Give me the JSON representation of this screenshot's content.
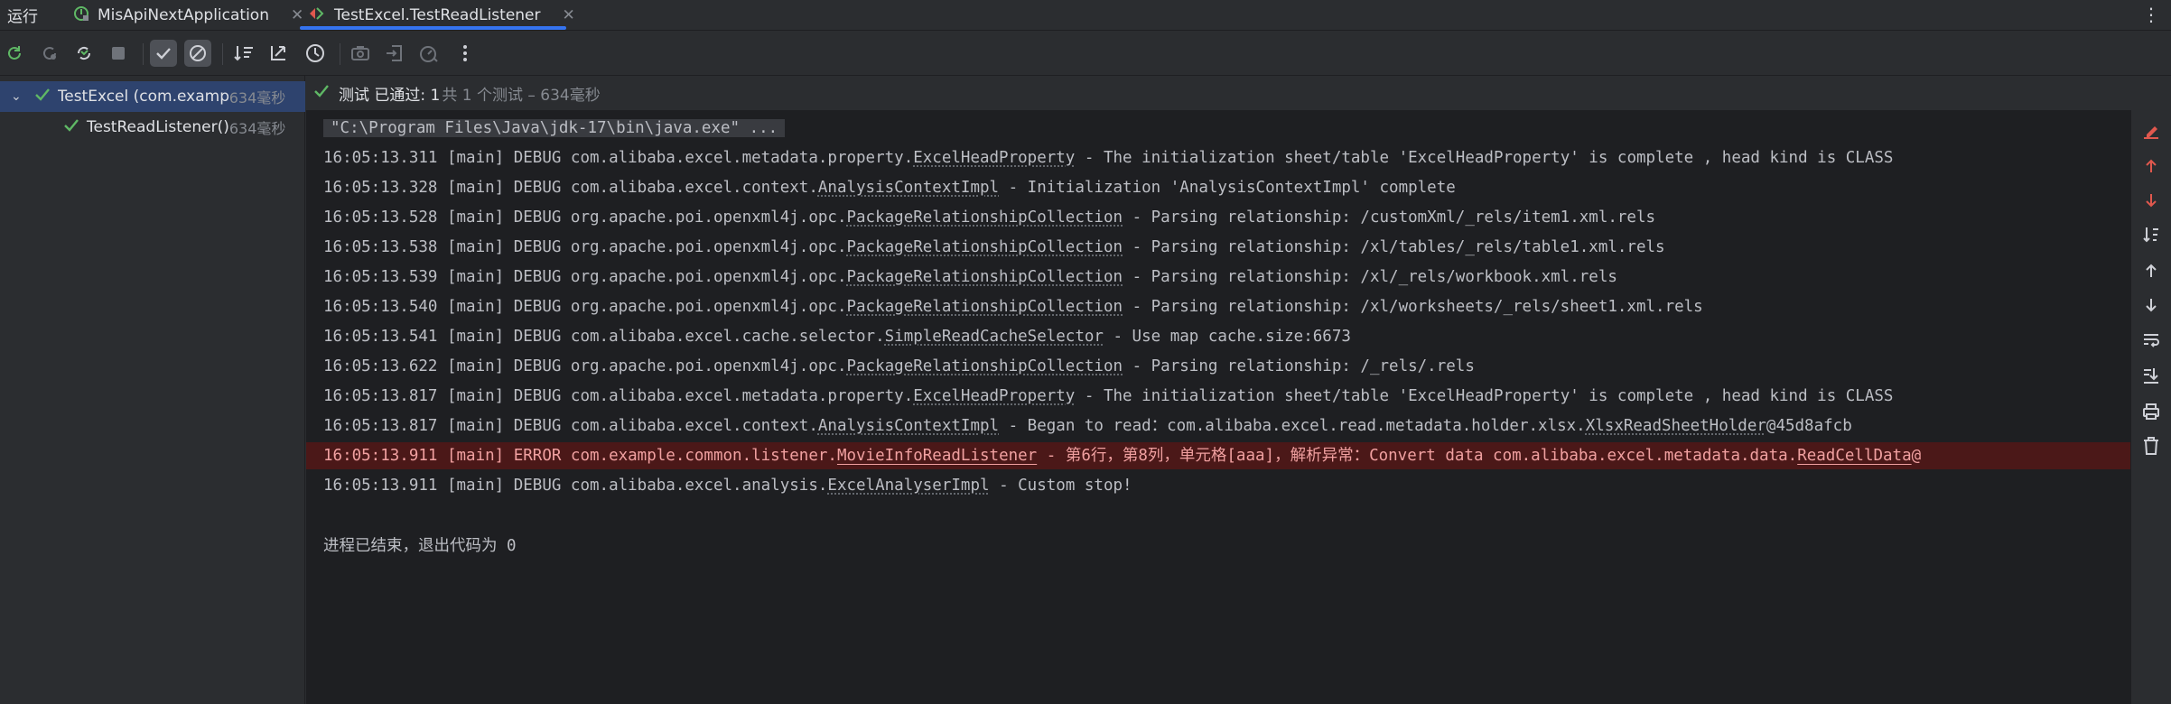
{
  "run_title": "运行",
  "tabs": [
    {
      "label": "MisApiNextApplication",
      "close": "✕"
    },
    {
      "label": "TestExcel.TestReadListener",
      "close": "✕"
    }
  ],
  "tree": {
    "root_label": "TestExcel (com.examp",
    "root_time": "634毫秒",
    "child_label": "TestReadListener()",
    "child_time": "634毫秒"
  },
  "status": {
    "passed": "测试 已通过: 1",
    "rest": "共 1 个测试 – 634毫秒"
  },
  "console": {
    "command": "\"C:\\Program Files\\Java\\jdk-17\\bin\\java.exe\" ...",
    "lines": [
      {
        "pre": "16:05:13.311 [main] DEBUG com.alibaba.excel.metadata.property.",
        "cls": "ExcelHeadProperty",
        "post": " - The initialization sheet/table 'ExcelHeadProperty' is complete , head kind is CLASS"
      },
      {
        "pre": "16:05:13.328 [main] DEBUG com.alibaba.excel.context.",
        "cls": "AnalysisContextImpl",
        "post": " - Initialization 'AnalysisContextImpl' complete"
      },
      {
        "pre": "16:05:13.528 [main] DEBUG org.apache.poi.openxml4j.opc.",
        "cls": "PackageRelationshipCollection",
        "post": " - Parsing relationship: /customXml/_rels/item1.xml.rels"
      },
      {
        "pre": "16:05:13.538 [main] DEBUG org.apache.poi.openxml4j.opc.",
        "cls": "PackageRelationshipCollection",
        "post": " - Parsing relationship: /xl/tables/_rels/table1.xml.rels"
      },
      {
        "pre": "16:05:13.539 [main] DEBUG org.apache.poi.openxml4j.opc.",
        "cls": "PackageRelationshipCollection",
        "post": " - Parsing relationship: /xl/_rels/workbook.xml.rels"
      },
      {
        "pre": "16:05:13.540 [main] DEBUG org.apache.poi.openxml4j.opc.",
        "cls": "PackageRelationshipCollection",
        "post": " - Parsing relationship: /xl/worksheets/_rels/sheet1.xml.rels"
      },
      {
        "pre": "16:05:13.541 [main] DEBUG com.alibaba.excel.cache.selector.",
        "cls": "SimpleReadCacheSelector",
        "post": " - Use map cache.size:6673"
      },
      {
        "pre": "16:05:13.622 [main] DEBUG org.apache.poi.openxml4j.opc.",
        "cls": "PackageRelationshipCollection",
        "post": " - Parsing relationship: /_rels/.rels"
      },
      {
        "pre": "16:05:13.817 [main] DEBUG com.alibaba.excel.metadata.property.",
        "cls": "ExcelHeadProperty",
        "post": " - The initialization sheet/table 'ExcelHeadProperty' is complete , head kind is CLASS"
      },
      {
        "pre": "16:05:13.817 [main] DEBUG com.alibaba.excel.context.",
        "cls": "AnalysisContextImpl",
        "post": " - Began to read：com.alibaba.excel.read.metadata.holder.xlsx.",
        "cls2": "XlsxReadSheetHolder",
        "post2": "@45d8afcb"
      },
      {
        "pre": "16:05:13.911 [main] ERROR com.example.common.listener.",
        "cls": "MovieInfoReadListener",
        "post": " - 第6行，第8列，单元格[aaa]，解析异常：Convert data com.alibaba.excel.metadata.data.",
        "cls2": "ReadCellData",
        "post2": "@"
      },
      {
        "pre": "16:05:13.911 [main] DEBUG com.alibaba.excel.analysis.",
        "cls": "ExcelAnalyserImpl",
        "post": " - Custom stop!"
      }
    ],
    "exit_message": "进程已结束，退出代码为 0"
  },
  "colors": {
    "pass": "#5fb865",
    "accent": "#3574f0",
    "error_bg": "#4b1818",
    "red_icon": "#e0584e"
  },
  "icons": [
    "rerun-icon",
    "rerun-failed-icon",
    "toggle-auto-test-icon",
    "stop-icon",
    "show-passed-icon",
    "show-ignored-icon",
    "sort-alpha-icon",
    "sort-duration-icon",
    "history-icon",
    "screenshot-icon",
    "import-tests-icon",
    "stopwatch-icon",
    "more-icon",
    "soft-wrap-icon",
    "up-arrow-icon",
    "down-arrow-icon",
    "scroll-to-end-icon",
    "print-icon",
    "trash-icon"
  ]
}
